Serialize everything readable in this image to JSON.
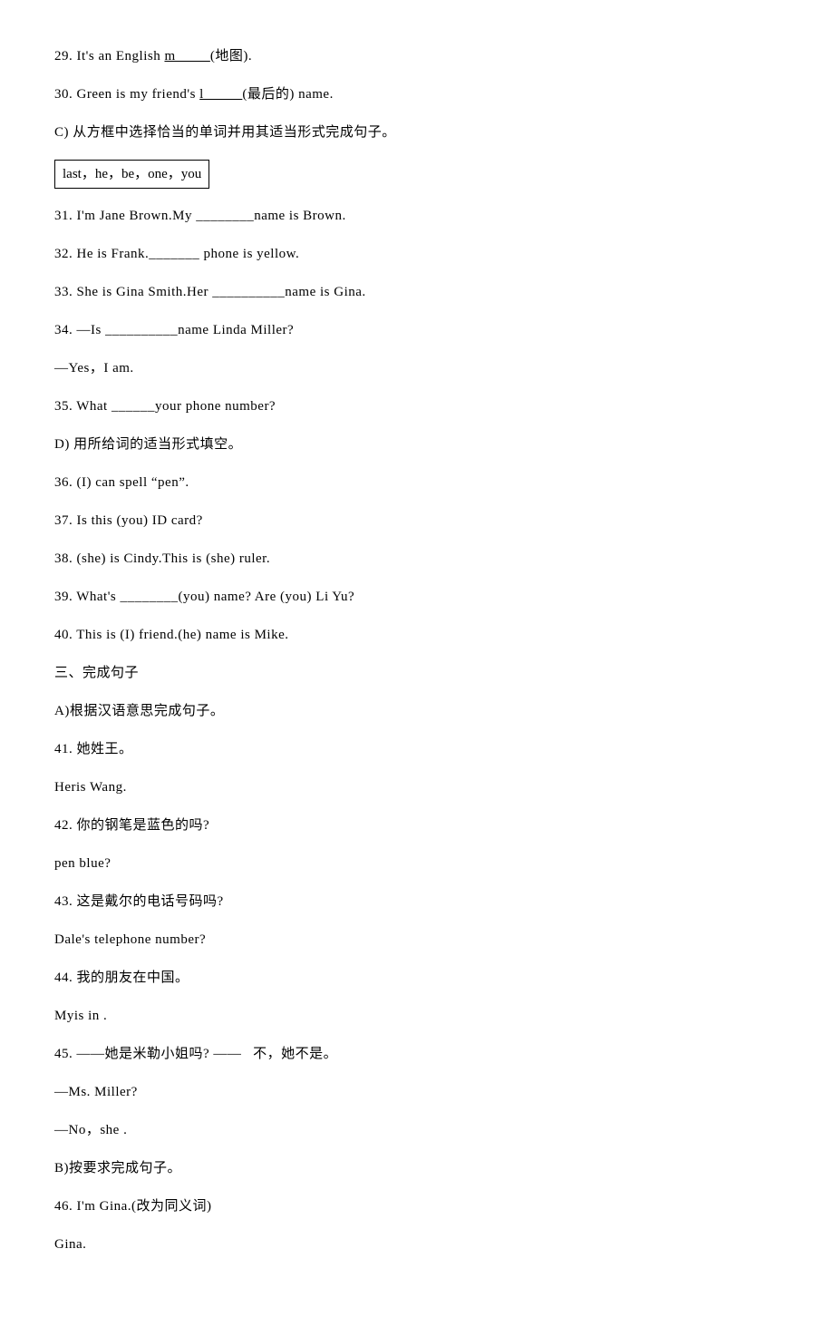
{
  "lines": {
    "q29": "29. It's an English ",
    "q29_u": "m         ",
    "q29_tail": "(地图).",
    "q30": "30. Green is my friend's ",
    "q30_u": "l          ",
    "q30_tail": "(最后的) name.",
    "section_c": "C) 从方框中选择恰当的单词并用其适当形式完成句子。",
    "word_box": "last，he，be，one，you",
    "q31": "31. I'm Jane Brown.My ________name is Brown.",
    "q32": "32. He is Frank._______ phone is yellow.",
    "q33": "33. She is Gina Smith.Her __________name is Gina.",
    "q34": "34. —Is __________name Linda Miller?",
    "q34b": "—Yes，I am.",
    "q35": "35. What ______your phone number?",
    "section_d": "D) 用所给词的适当形式填空。",
    "q36": "36. (I) can spell “pen”.",
    "q37": "37. Is this (you) ID card?",
    "q38": "38. (she) is Cindy.This is  (she) ruler.",
    "q39": "39. What's ________(you) name? Are (you) Li Yu?",
    "q40": "40. This is (I) friend.(he) name is Mike.",
    "section_3": "三、完成句子",
    "section_a": "A)根据汉语意思完成句子。",
    "q41": "41. 她姓王。",
    "q41a": "Heris Wang.",
    "q42": "42. 你的钢笔是蓝色的吗?",
    "q42a": "pen blue?",
    "q43": "43. 这是戴尔的电话号码吗?",
    "q43a": "Dale's telephone number?",
    "q44": "44. 我的朋友在中国。",
    "q44a": "Myis in .",
    "q45": "45. ——她是米勒小姐吗? ——   不，她不是。",
    "q45a": "—Ms. Miller?",
    "q45b": "—No，she .",
    "section_b": "B)按要求完成句子。",
    "q46": "46. I'm Gina.(改为同义词)",
    "q46a": "Gina."
  }
}
